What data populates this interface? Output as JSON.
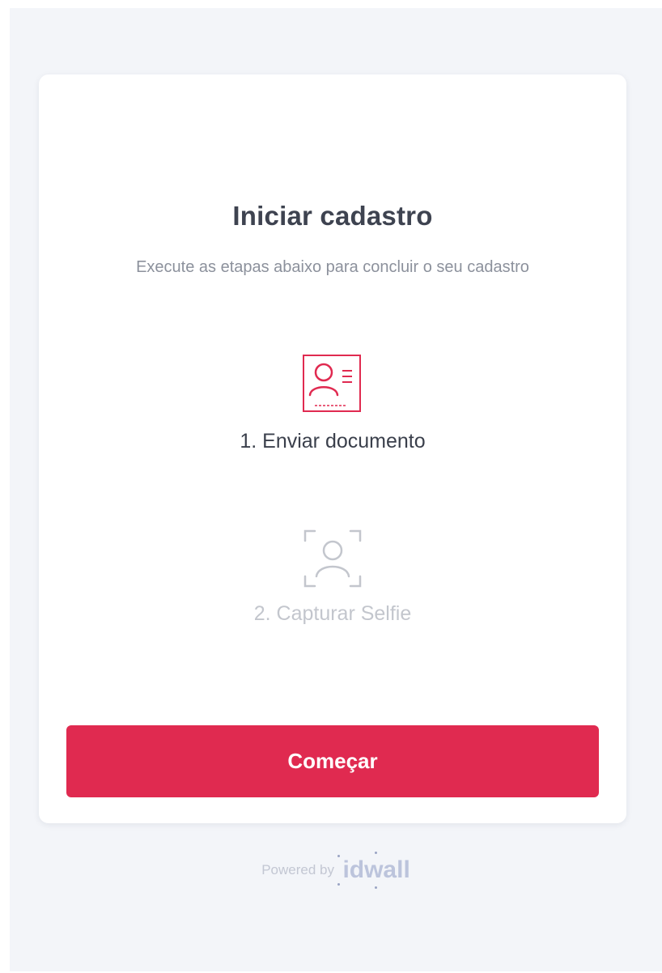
{
  "card": {
    "title": "Iniciar cadastro",
    "subtitle": "Execute as etapas abaixo para concluir o seu cadastro",
    "steps": [
      {
        "label": "1. Enviar documento",
        "icon": "id-card-icon",
        "state": "active",
        "color": "#e02a50"
      },
      {
        "label": "2. Capturar Selfie",
        "icon": "face-scan-icon",
        "state": "inactive",
        "color": "#c3c6cd"
      }
    ],
    "button_label": "Começar",
    "button_color": "#e02a50"
  },
  "footer": {
    "powered_by": "Powered by",
    "brand": "idwall"
  },
  "colors": {
    "background": "#f3f5f9",
    "card": "#ffffff",
    "accent": "#e02a50"
  }
}
